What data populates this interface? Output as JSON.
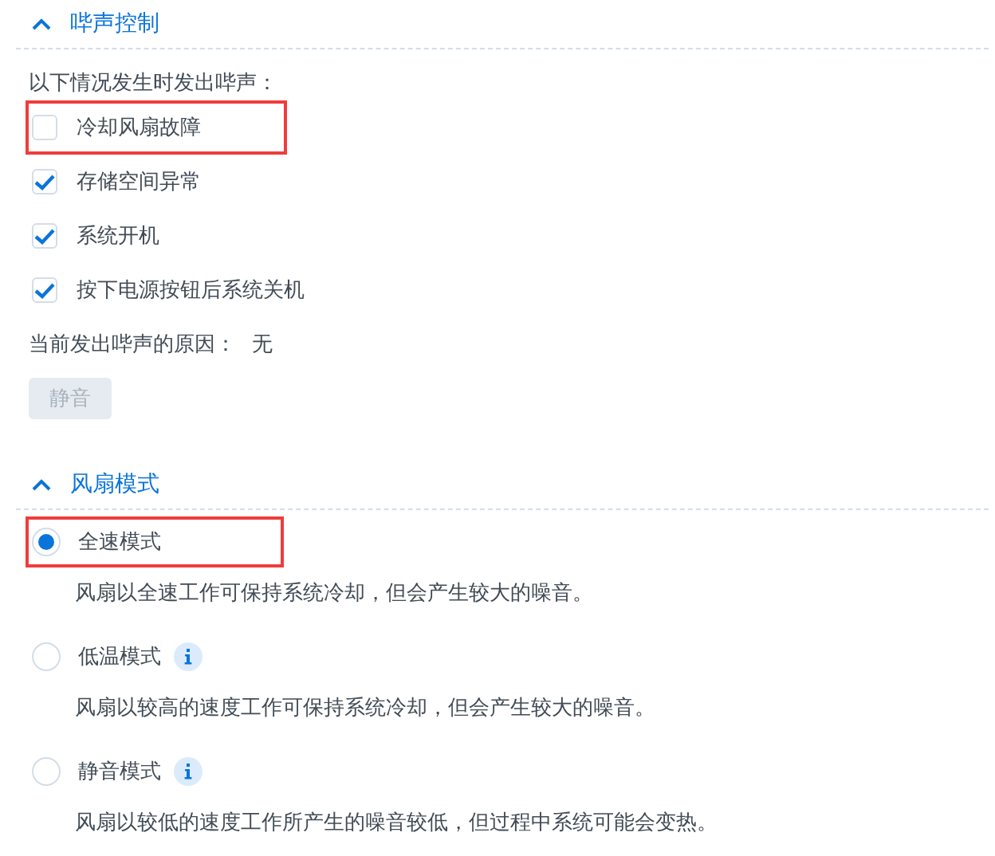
{
  "beep_section": {
    "title": "哔声控制",
    "expanded": true,
    "intro": "以下情况发生时发出哔声：",
    "options": [
      {
        "label": "冷却风扇故障",
        "checked": false,
        "highlighted": true
      },
      {
        "label": "存储空间异常",
        "checked": true,
        "highlighted": false
      },
      {
        "label": "系统开机",
        "checked": true,
        "highlighted": false
      },
      {
        "label": "按下电源按钮后系统关机",
        "checked": true,
        "highlighted": false
      }
    ],
    "reason_label": "当前发出哔声的原因：",
    "reason_value": "无",
    "mute_button": {
      "label": "静音",
      "disabled": true
    }
  },
  "fan_section": {
    "title": "风扇模式",
    "expanded": true,
    "modes": [
      {
        "label": "全速模式",
        "selected": true,
        "info": false,
        "highlighted": true,
        "description": "风扇以全速工作可保持系统冷却，但会产生较大的噪音。"
      },
      {
        "label": "低温模式",
        "selected": false,
        "info": true,
        "highlighted": false,
        "description": "风扇以较高的速度工作可保持系统冷却，但会产生较大的噪音。"
      },
      {
        "label": "静音模式",
        "selected": false,
        "info": true,
        "highlighted": false,
        "description": "风扇以较低的速度工作所产生的噪音较低，但过程中系统可能会变热。"
      }
    ]
  }
}
